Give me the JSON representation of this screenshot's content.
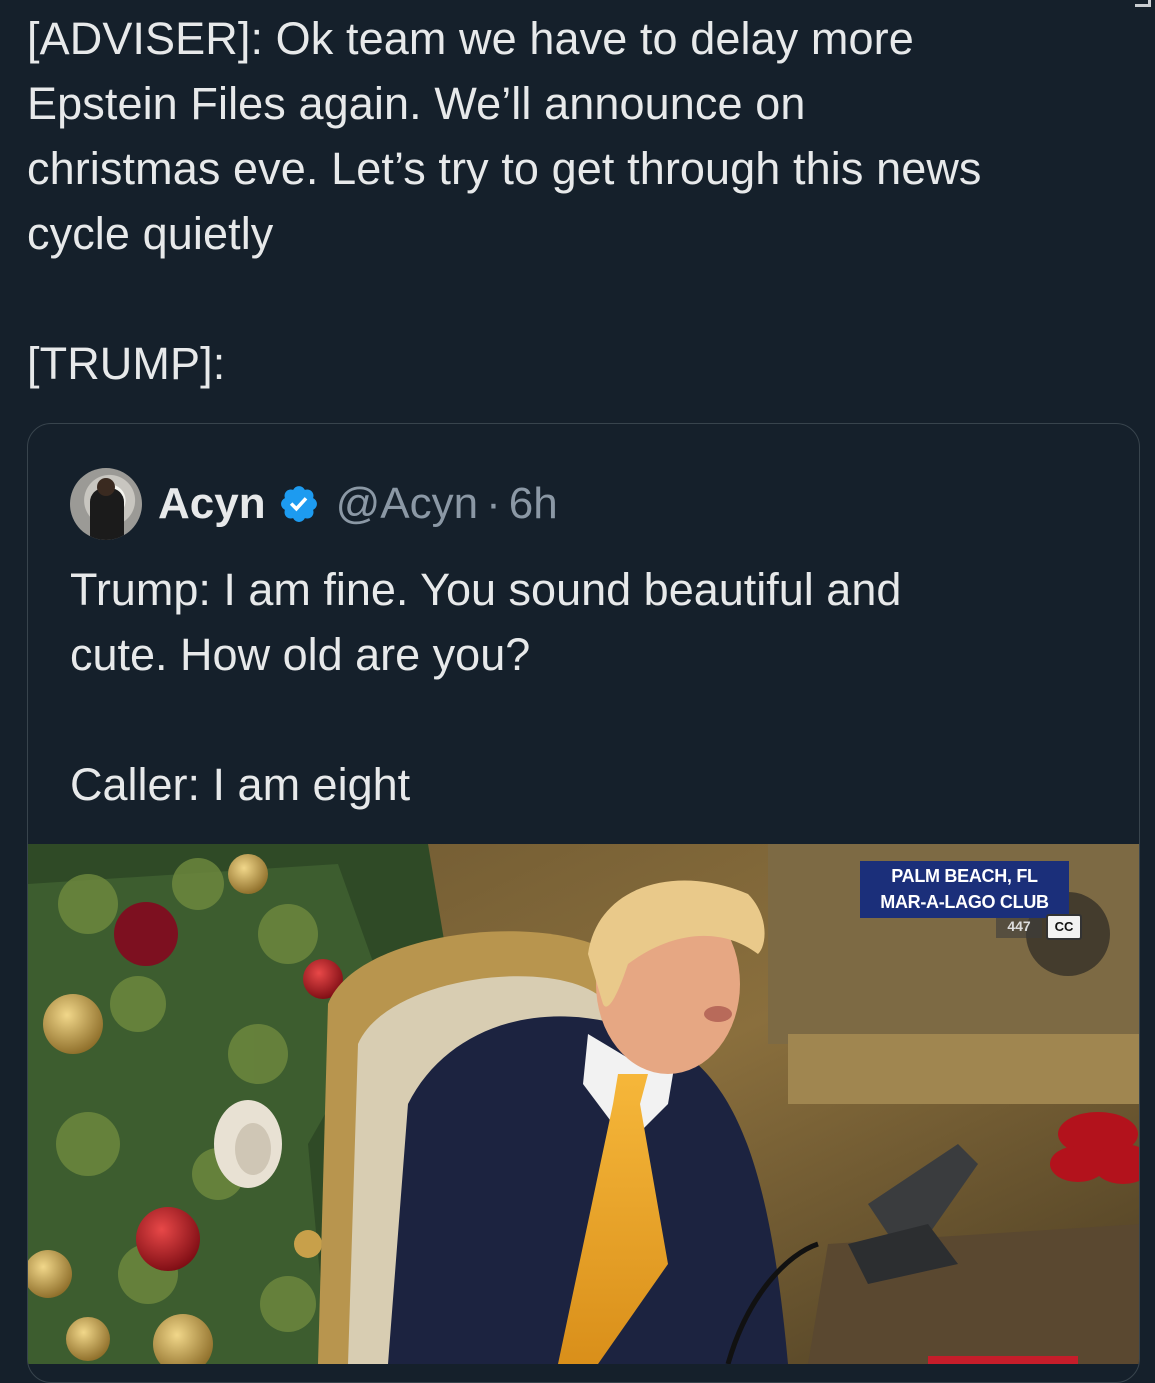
{
  "tweet": {
    "text": "[ADVISER]: Ok team we have to delay more\nEpstein Files again. We’ll announce on\nchristmas eve. Let’s try to get through this news\ncycle quietly\n\n[TRUMP]:"
  },
  "quote": {
    "author_name": "Acyn",
    "verified": true,
    "handle": "@Acyn",
    "separator": "·",
    "time": "6h",
    "text": "Trump: I am fine. You sound beautiful and\ncute. How old are you?\n\nCaller: I am eight"
  },
  "video": {
    "location_line1": "PALM BEACH, FL",
    "location_line2": "MAR-A-LAGO CLUB",
    "channel_bug": "447",
    "cc_label": "CC"
  },
  "colors": {
    "background": "#15202b",
    "text": "#e7e9ea",
    "muted": "#8b98a5",
    "border": "#38444d",
    "verified_badge": "#1d9bf0",
    "banner": "#1b2f7a"
  }
}
